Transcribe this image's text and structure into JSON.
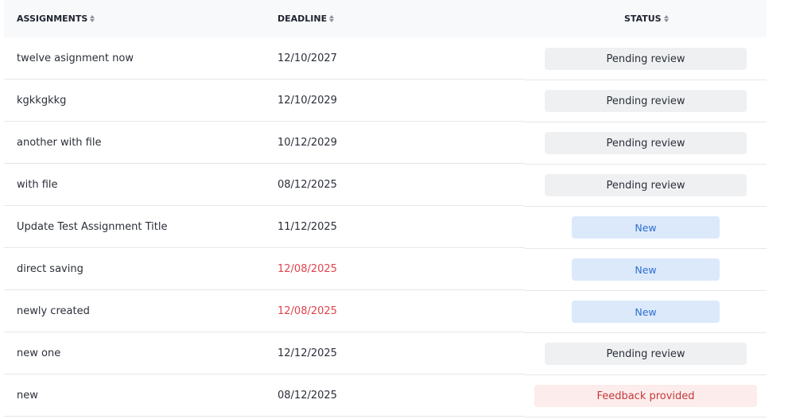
{
  "headers": {
    "assignments": "ASSIGNMENTS",
    "deadline": "DEADLINE",
    "status": "STATUS"
  },
  "rows": [
    {
      "title": "twelve asignment now",
      "deadline": "12/10/2027",
      "deadline_overdue": false,
      "status": "Pending review",
      "status_kind": "pending"
    },
    {
      "title": "kgkkgkkg",
      "deadline": "12/10/2029",
      "deadline_overdue": false,
      "status": "Pending review",
      "status_kind": "pending"
    },
    {
      "title": "another with file",
      "deadline": "10/12/2029",
      "deadline_overdue": false,
      "status": "Pending review",
      "status_kind": "pending"
    },
    {
      "title": "with file",
      "deadline": "08/12/2025",
      "deadline_overdue": false,
      "status": "Pending review",
      "status_kind": "pending"
    },
    {
      "title": "Update Test Assignment Title",
      "deadline": "11/12/2025",
      "deadline_overdue": false,
      "status": "New",
      "status_kind": "new"
    },
    {
      "title": "direct saving",
      "deadline": "12/08/2025",
      "deadline_overdue": true,
      "status": "New",
      "status_kind": "new"
    },
    {
      "title": "newly created",
      "deadline": "12/08/2025",
      "deadline_overdue": true,
      "status": "New",
      "status_kind": "new"
    },
    {
      "title": "new one",
      "deadline": "12/12/2025",
      "deadline_overdue": false,
      "status": "Pending review",
      "status_kind": "pending"
    },
    {
      "title": "new",
      "deadline": "08/12/2025",
      "deadline_overdue": false,
      "status": "Feedback provided",
      "status_kind": "feedback"
    }
  ],
  "colors": {
    "header_bg": "#f8f9fa",
    "overdue": "#e0434b",
    "pending_bg": "#eef0f2",
    "new_bg": "#dbe9fb",
    "new_text": "#2f6fd0",
    "feedback_bg": "#fdecec",
    "feedback_text": "#c43a3a"
  },
  "icons": {
    "sort": "sort-updown-icon"
  }
}
